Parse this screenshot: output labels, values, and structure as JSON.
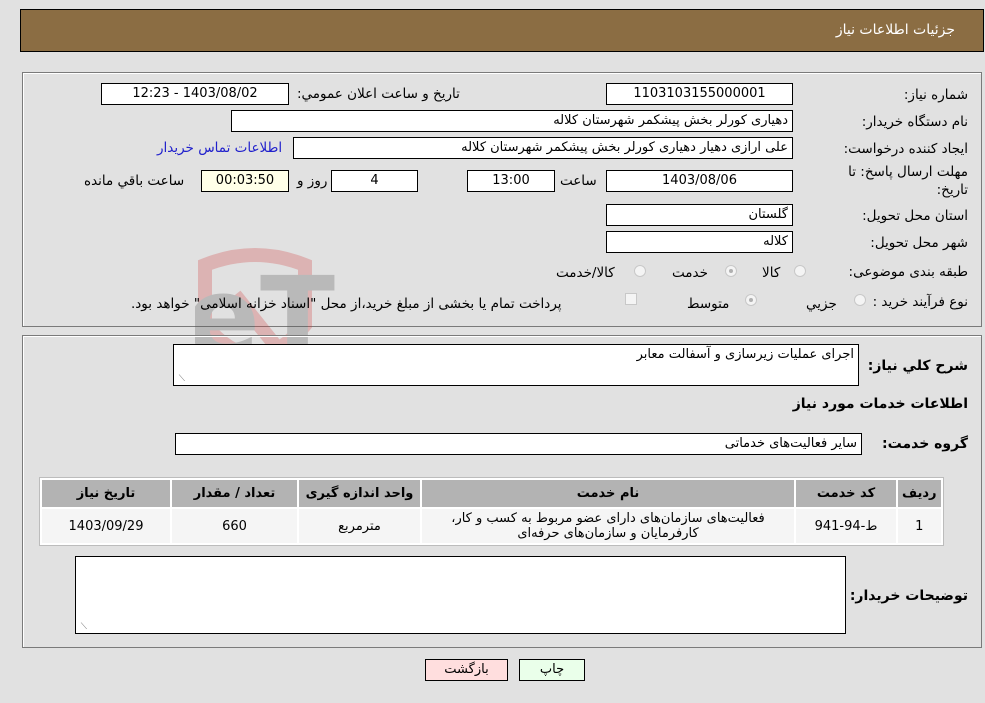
{
  "header": {
    "title": "جزئیات اطلاعات نیاز"
  },
  "form": {
    "need_number": {
      "label": "شماره نیاز:",
      "value": "1103103155000001"
    },
    "announce_datetime": {
      "label": "تاريخ و ساعت اعلان عمومي:",
      "value": "1403/08/02 - 12:23"
    },
    "buyer_org": {
      "label": "نام دستگاه خریدار:",
      "value": "دهیاری کورلر بخش پیشکمر شهرستان کلاله"
    },
    "requester": {
      "label": "ایجاد کننده درخواست:",
      "value": "علی ارازی دهیار دهیاری کورلر بخش پیشکمر شهرستان کلاله"
    },
    "contact_link": "اطلاعات تماس خریدار",
    "deadline": {
      "label_line1": "مهلت ارسال پاسخ: تا",
      "label_line2": "تاریخ:",
      "date": "1403/08/06",
      "time_label": "ساعت",
      "time": "13:00",
      "days": "4",
      "days_label": "روز و",
      "remaining": "00:03:50",
      "remaining_label": "ساعت باقي مانده"
    },
    "province": {
      "label": "استان محل تحویل:",
      "value": "گلستان"
    },
    "city": {
      "label": "شهر محل تحویل:",
      "value": "کلاله"
    },
    "category": {
      "label": "طبقه بندی موضوعی:",
      "options": [
        "کالا",
        "خدمت",
        "کالا/خدمت"
      ],
      "selected": "خدمت"
    },
    "purchase_type": {
      "label": "نوع فرآیند خرید :",
      "options": [
        "جزيي",
        "متوسط"
      ],
      "selected": "متوسط",
      "treasury_checkbox_label": "پرداخت تمام یا بخشی از مبلغ خرید،از محل \"اسناد خزانه اسلامی\" خواهد بود.",
      "treasury_checked": false
    }
  },
  "details": {
    "description_label": "شرح کلي نياز:",
    "description_value": "اجرای عملیات زیرسازی و آسفالت معابر",
    "services_title": "اطلاعات خدمات مورد نیاز",
    "service_group_label": "گروه خدمت:",
    "service_group_value": "سایر فعالیت‌های خدماتی",
    "table": {
      "columns": [
        "ردیف",
        "کد خدمت",
        "نام خدمت",
        "واحد اندازه گیری",
        "تعداد / مقدار",
        "تاریخ نیاز"
      ],
      "rows": [
        {
          "row": "1",
          "code": "ط-94-941",
          "name": "فعالیت‌های سازمان‌های دارای عضو مربوط به کسب و کار، کارفرمایان و سازمان‌های حرفه‌ای",
          "unit": "مترمربع",
          "quantity": "660",
          "date": "1403/09/29"
        }
      ]
    },
    "buyer_notes_label": "توضیحات خریدار:",
    "buyer_notes_value": ""
  },
  "buttons": {
    "print": "چاپ",
    "back": "بازگشت"
  },
  "colors": {
    "header_bg": "#8b6d43",
    "link": "#2020cc",
    "remaining_bg": "#ffffe8",
    "print_bg": "#eaffea",
    "back_bg": "#ffdede"
  }
}
